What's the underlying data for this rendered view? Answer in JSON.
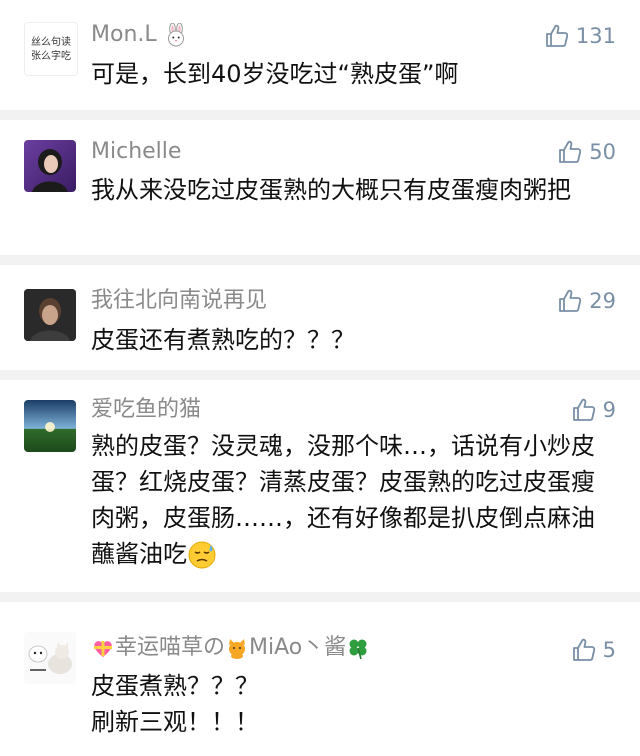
{
  "comments": [
    {
      "name": "Mon.L",
      "name_emoji": "rabbit-face",
      "likes": "131",
      "avatar_text": [
        "丝么句读",
        "张么字吃"
      ],
      "text": "可是，长到40岁没吃过“熟皮蛋”啊"
    },
    {
      "name": "Michelle",
      "likes": "50",
      "text": "我从来没吃过皮蛋熟的大概只有皮蛋瘦肉粥把"
    },
    {
      "name": "我往北向南说再见",
      "likes": "29",
      "text": "皮蛋还有煮熟吃的？？？"
    },
    {
      "name": "爱吃鱼的猫",
      "likes": "9",
      "text": "熟的皮蛋？没灵魂，没那个味…，话说有小炒皮蛋？红烧皮蛋？清蒸皮蛋？皮蛋熟的吃过皮蛋瘦肉粥，皮蛋肠……，还有好像都是扒皮倒点麻油蘸酱油吃",
      "trailing_emoji": "downcast-face-with-sweat"
    },
    {
      "name_prefix_emoji": "heart-with-ribbon",
      "name_part1": "幸运喵草の",
      "name_mid_emoji": "cat",
      "name_part2": "MiAo丶酱",
      "name_suffix_emoji": "four-leaf-clover",
      "likes": "5",
      "text_line1": "皮蛋煮熟？？？",
      "text_line2": "刷新三观！！！"
    }
  ],
  "colors": {
    "name": "#8a8a8a",
    "likes": "#7a8fa6",
    "text": "#111111",
    "separator": "#f2f2f2"
  }
}
